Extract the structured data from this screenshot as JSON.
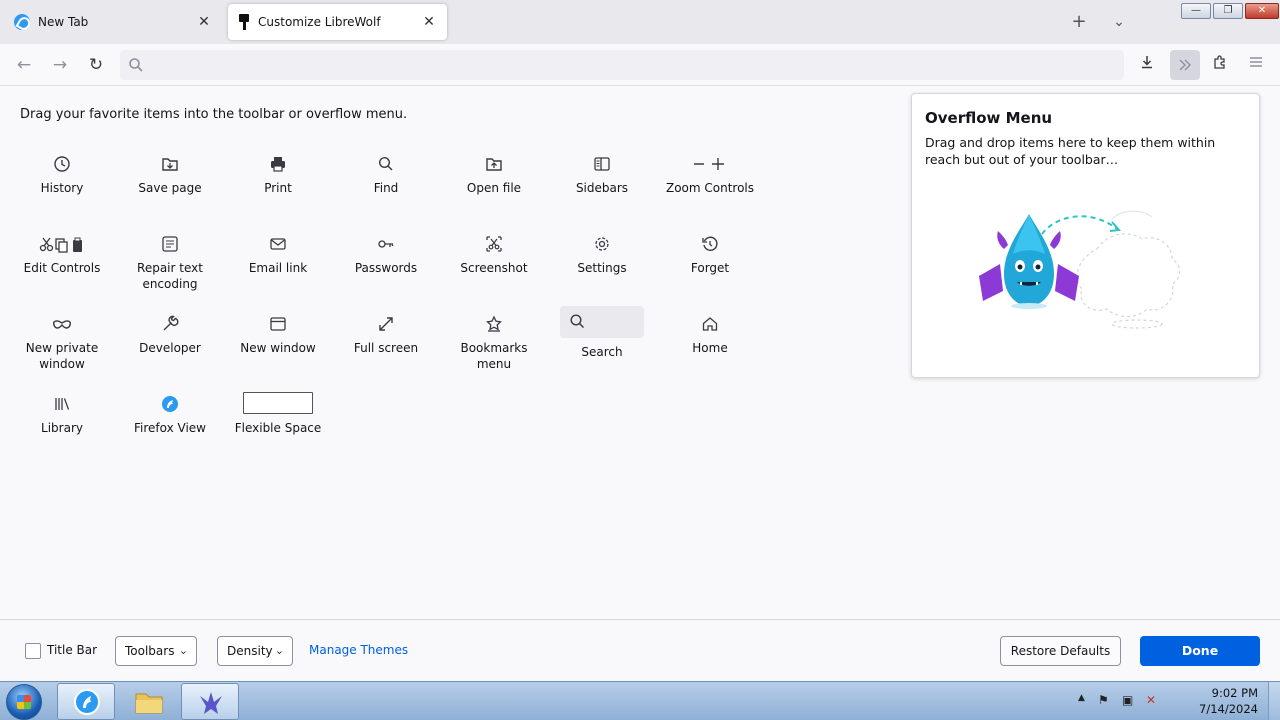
{
  "tabs": [
    {
      "label": "New Tab",
      "icon": "librewolf-icon",
      "active": false
    },
    {
      "label": "Customize LibreWolf",
      "icon": "customize-brush-icon",
      "active": true
    }
  ],
  "tabstrip": {
    "new_tab_symbol": "+",
    "list_all_tabs_symbol": "⌄"
  },
  "window_controls": {
    "minimize": "—",
    "restore": "❐",
    "close": "✕"
  },
  "navbar": {
    "back": "←",
    "forward": "→",
    "reload": "↻",
    "url_value": "",
    "url_placeholder": ""
  },
  "palette": {
    "instructions": "Drag your favorite items into the toolbar or overflow menu.",
    "items": [
      {
        "label": "History",
        "icon": "history-icon"
      },
      {
        "label": "Save page",
        "icon": "save-page-icon"
      },
      {
        "label": "Print",
        "icon": "print-icon"
      },
      {
        "label": "Find",
        "icon": "find-icon"
      },
      {
        "label": "Open file",
        "icon": "open-file-icon"
      },
      {
        "label": "Sidebars",
        "icon": "sidebars-icon"
      },
      {
        "label": "Zoom Controls",
        "icon": "zoom-controls-icon"
      },
      {
        "label": "Edit Controls",
        "icon": "edit-controls-icon"
      },
      {
        "label": "Repair text encoding",
        "icon": "text-encoding-icon"
      },
      {
        "label": "Email link",
        "icon": "email-icon"
      },
      {
        "label": "Passwords",
        "icon": "key-icon"
      },
      {
        "label": "Screenshot",
        "icon": "screenshot-icon"
      },
      {
        "label": "Settings",
        "icon": "gear-icon"
      },
      {
        "label": "Forget",
        "icon": "forget-icon"
      },
      {
        "label": "New private window",
        "icon": "private-mask-icon"
      },
      {
        "label": "Developer",
        "icon": "wrench-icon"
      },
      {
        "label": "New window",
        "icon": "new-window-icon"
      },
      {
        "label": "Full screen",
        "icon": "fullscreen-icon"
      },
      {
        "label": "Bookmarks menu",
        "icon": "bookmarks-star-icon"
      },
      {
        "label": "Search",
        "icon": "search-icon"
      },
      {
        "label": "Home",
        "icon": "home-icon"
      },
      {
        "label": "Library",
        "icon": "library-icon"
      },
      {
        "label": "Firefox View",
        "icon": "firefox-view-icon"
      },
      {
        "label": "Flexible Space",
        "icon": "flexible-space-icon"
      }
    ]
  },
  "overflow_panel": {
    "title": "Overflow Menu",
    "description": "Drag and drop items here to keep them within reach but out of your toolbar…"
  },
  "footer": {
    "title_bar_label": "Title Bar",
    "title_bar_checked": false,
    "toolbars_label": "Toolbars",
    "density_label": "Density",
    "manage_themes": "Manage Themes",
    "restore_defaults": "Restore Defaults",
    "done": "Done"
  },
  "taskbar": {
    "time": "9:02 PM",
    "date": "7/14/2024",
    "apps": [
      "librewolf-taskbar-icon",
      "explorer-folder-icon",
      "dragon-app-icon"
    ]
  },
  "colors": {
    "accent": "#0061e0",
    "tabstrip_bg": "#e8e8ed",
    "page_bg": "#f9f9fb",
    "librewolf_blue": "#2b9af3"
  }
}
